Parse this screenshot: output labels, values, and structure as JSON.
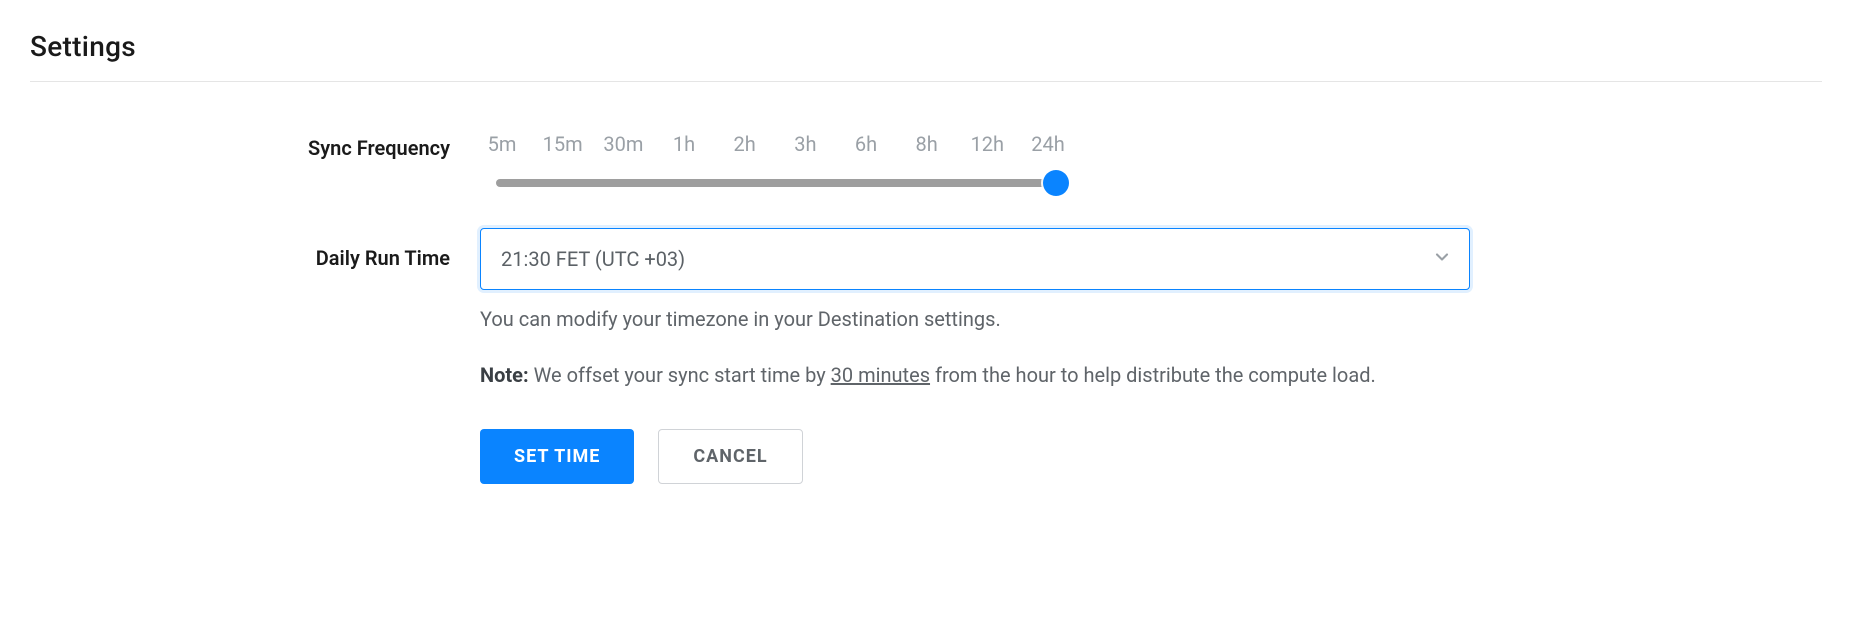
{
  "page": {
    "title": "Settings"
  },
  "syncFrequency": {
    "label": "Sync Frequency",
    "ticks": [
      "5m",
      "15m",
      "30m",
      "1h",
      "2h",
      "3h",
      "6h",
      "8h",
      "12h",
      "24h"
    ],
    "selectedIndex": 9
  },
  "dailyRunTime": {
    "label": "Daily Run Time",
    "value": "21:30 FET (UTC +03)",
    "helper": "You can modify your timezone in your Destination settings.",
    "note": {
      "label": "Note:",
      "prefix": " We offset your sync start time by ",
      "offset": "30 minutes",
      "suffix": " from the hour to help distribute the compute load."
    }
  },
  "buttons": {
    "primary": "SET TIME",
    "secondary": "CANCEL"
  }
}
